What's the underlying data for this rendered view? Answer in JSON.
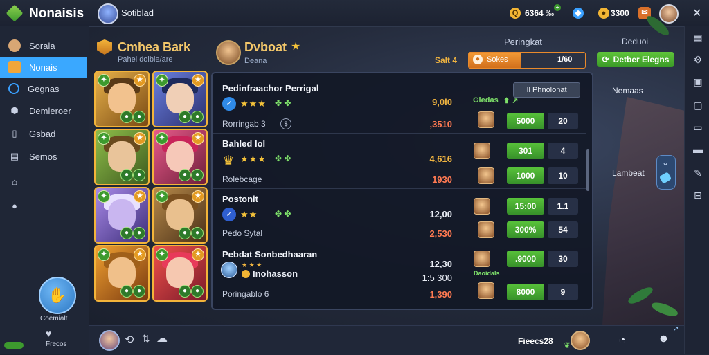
{
  "app": {
    "title": "Nonaisis",
    "user_name": "Sotiblad"
  },
  "resources": [
    {
      "icon": "coin-icon",
      "value": "6364 ‰",
      "color": "#f2b534"
    },
    {
      "icon": "gem-icon",
      "value": "",
      "color": "#3aa0ff"
    },
    {
      "icon": "gold-icon",
      "value": "3300",
      "color": "#f2b534"
    }
  ],
  "sidebar": {
    "items": [
      {
        "label": "Sorala",
        "icon": "avatar-icon"
      },
      {
        "label": "Nonais",
        "icon": "chest-icon",
        "active": true
      },
      {
        "label": "Gegnas",
        "icon": "chat-icon"
      },
      {
        "label": "Demleroer",
        "icon": "settings-icon"
      },
      {
        "label": "Gsbad",
        "icon": "book-icon"
      },
      {
        "label": "Semos",
        "icon": "calendar-icon"
      },
      {
        "label": "",
        "icon": "home-icon"
      },
      {
        "label": "",
        "icon": "support-icon"
      }
    ],
    "help_label": "Coemialt",
    "friends_label": "Frecos"
  },
  "heroes_panel": {
    "title": "Cmhea Bark",
    "subtitle": "Pahel dolbie/are",
    "cards": [
      {
        "palette": "gold"
      },
      {
        "palette": "blue"
      },
      {
        "palette": "green"
      },
      {
        "palette": "pink"
      },
      {
        "palette": "purple"
      },
      {
        "palette": "brown"
      },
      {
        "palette": "orange"
      },
      {
        "palette": "red"
      }
    ]
  },
  "profile": {
    "name": "Dvboat",
    "subtitle": "Deana"
  },
  "progress": {
    "label": "Sokes",
    "left_label": "Salt 4",
    "value_text": "1/60",
    "fraction": 0.45
  },
  "top_right": {
    "title": "Peringkat",
    "action_title": "Deduoi",
    "action_button": "Detber Elegns",
    "side_label": "Nemaas",
    "side_label2": "Lambeat"
  },
  "board": {
    "header_green": "Gledas",
    "header_chip": "Il Phnolonat",
    "rows": [
      {
        "title": "Pedinfraachor Perrigal",
        "stars": "★★★",
        "value1": "9,0l0",
        "value2": ",3510",
        "sub": "Rorringab 3",
        "btn1": "5000",
        "score1": "20",
        "btn2": "",
        "score2": ""
      },
      {
        "title": "Bahled lol",
        "stars": "★★★",
        "value1": "4,616",
        "value2": "1930",
        "sub": "Rolebcage",
        "btn1": "301",
        "score1": "4",
        "btn2": "1000",
        "score2": "10"
      },
      {
        "title": "Postonit",
        "stars": "★★",
        "value1": "12,00",
        "value2": "2,530",
        "sub": "Pedo Sytal",
        "btn1": "15:00",
        "score1": "1.1",
        "btn2": "300%",
        "score2": "54"
      },
      {
        "title": "Pebdat Sonbedhaaran",
        "stars": "Inohasson",
        "value1": "12,30",
        "value2": "1:5 300",
        "sub": "Poringablo 6",
        "btn1": ".9000",
        "score1": "30",
        "btn2": "8000",
        "score2": "9"
      }
    ],
    "extra_sub": "Daoidals",
    "value_extra": "1,390"
  },
  "bottom": {
    "right_label": "Fieecs28"
  }
}
